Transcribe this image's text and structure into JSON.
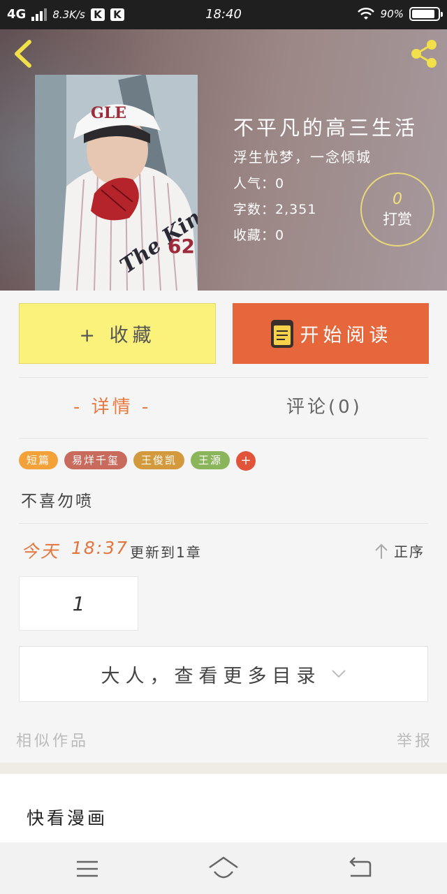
{
  "status_bar": {
    "network": "4G",
    "speed": "8.3K/s",
    "app_badges": [
      "K",
      "K"
    ],
    "time": "18:40",
    "battery": "90%",
    "battery_level": 0.9
  },
  "book": {
    "title": "不平凡的高三生活",
    "subtitle": "浮生忧梦，一念倾城",
    "popularity_label": "人气：",
    "popularity": "0",
    "words_label": "字数：",
    "words": "2,351",
    "favorites_label": "收藏：",
    "favorites": "0",
    "reward_count": "0",
    "reward_label": "打赏"
  },
  "actions": {
    "collect_label": "+ 收藏",
    "read_label": "开始阅读"
  },
  "tabs": {
    "detail": "- 详情 -",
    "comments": "评论(0)"
  },
  "tags": [
    {
      "label": "短篇",
      "color": "#f3a23a"
    },
    {
      "label": "易烊千玺",
      "color": "#c86b5c"
    },
    {
      "label": "王俊凯",
      "color": "#d39a3d"
    },
    {
      "label": "王源",
      "color": "#8bb55a"
    }
  ],
  "tag_add": "+",
  "intro": "不喜勿喷",
  "update": {
    "day": "今天",
    "time": "18:37",
    "text": "更新到1章",
    "order_label": "正序"
  },
  "chapters": [
    "1"
  ],
  "more_catalog": "大人，查看更多目录",
  "footer_links": {
    "similar": "相似作品",
    "report": "举报"
  },
  "ad": {
    "title": "快看漫画"
  },
  "colors": {
    "accent_orange": "#e6673c",
    "collect_yellow": "#fbf27b",
    "reward_ring": "#e8d87a"
  }
}
